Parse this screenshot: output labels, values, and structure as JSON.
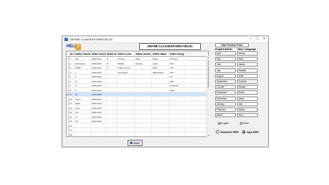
{
  "window": {
    "title": "DEFINE CLASSES/FORM FIELDS",
    "minimize": "–",
    "maximize": "□",
    "close": "×"
  },
  "help": {
    "label": "HELP",
    "icon": "?"
  },
  "heading": "DEFINE CLASSES/FORM FIELDS",
  "grid": {
    "columns": [
      "Sr.#",
      "Define Classes",
      "Define Session",
      "Define Section",
      "Define Level",
      "Define Gender",
      "Define Name",
      "Define Designation"
    ],
    "rows": [
      [
        "1",
        "Ech",
        "2020-2021",
        "A",
        "Primary",
        "Male",
        "Bank",
        "Principal"
      ],
      [
        "2",
        "Montessori",
        "2020-2021",
        "B",
        "Middle",
        "Female",
        "Cash",
        "SST"
      ],
      [
        "3",
        "PREP",
        "2020-2021",
        "C",
        "Higher Secon",
        "",
        "Bank",
        "JST"
      ],
      [
        "4",
        "I",
        "2020-2021",
        "",
        "Secondary",
        "",
        "jaBnk/Jawer",
        "PST"
      ],
      [
        "5",
        "II",
        "2020-2021",
        "",
        "",
        "",
        "",
        "OT"
      ],
      [
        "6",
        "III",
        "2020-2021",
        "",
        "",
        "",
        "",
        "PET"
      ],
      [
        "7",
        "IV",
        "2020-2021",
        "",
        "",
        "",
        "",
        "H.Master"
      ],
      [
        "8",
        "V",
        "2020-2021",
        "",
        "",
        "",
        "",
        "Clerk"
      ],
      [
        "9",
        "VI",
        "2020-2021",
        "",
        "",
        "",
        "",
        ""
      ],
      [
        "10",
        "Xxxxx",
        "2020-2021",
        "",
        "",
        "",
        "",
        ""
      ],
      [
        "11",
        "Eight",
        "2020-2021",
        "",
        "",
        "",
        "",
        ""
      ],
      [
        "12",
        "Nine",
        "2020-2021",
        "",
        "",
        "",
        "",
        ""
      ],
      [
        "13",
        "Ten",
        "2020-2021",
        "",
        "",
        "",
        "",
        ""
      ],
      [
        "14",
        "XI",
        "2020-2021",
        "",
        "",
        "",
        "",
        ""
      ],
      [
        "15",
        "XII",
        "2020-2021",
        "",
        "",
        "",
        "",
        ""
      ],
      [
        "16",
        "",
        "",
        "",
        "",
        "",
        "",
        ""
      ],
      [
        "17",
        "",
        "",
        "",
        "",
        "",
        "",
        ""
      ],
      [
        "18",
        "",
        "",
        "",
        "",
        "",
        "",
        ""
      ]
    ],
    "selected_index": 8,
    "row_marker": "►"
  },
  "save_label": "Save",
  "months_panel": {
    "session_start_button": "Start Session From",
    "english_header": "English Month",
    "other_header": "Other Language",
    "english": [
      "April",
      "May",
      "June",
      "July",
      "August",
      "September",
      "October",
      "November",
      "December",
      "January",
      "February",
      "March"
    ],
    "other": [
      "Hamal",
      "Sawr",
      "Jawza",
      "Saratan",
      "Asad",
      "Sunbula",
      "Mizaan",
      "Akrab",
      "Qaws",
      "Jadi",
      "Dalwa",
      "Hoot"
    ],
    "radio_english": "English",
    "radio_other": "Other",
    "selected_language": "English"
  },
  "sms": {
    "branded_label": "Branded SMS",
    "app_label": "App SMS",
    "selected": "App SMS"
  }
}
